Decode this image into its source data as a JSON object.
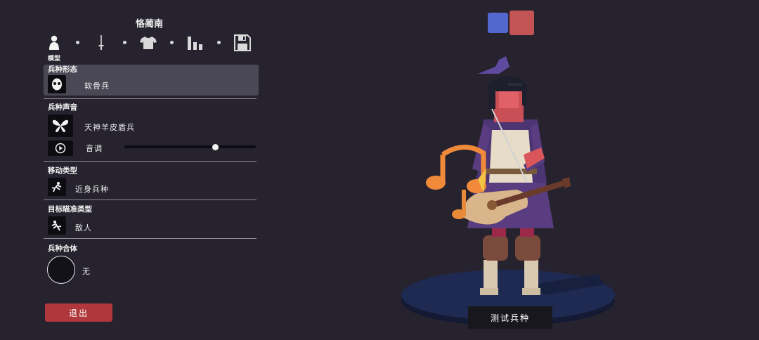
{
  "title": "恪蔺南",
  "tabs": [
    {
      "icon": "person-icon",
      "label": "模型"
    },
    {
      "icon": "sword-icon",
      "label": ""
    },
    {
      "icon": "shirt-icon",
      "label": ""
    },
    {
      "icon": "bars-icon",
      "label": ""
    },
    {
      "icon": "save-icon",
      "label": ""
    }
  ],
  "sections": {
    "form": {
      "label": "兵种形态",
      "value": "软骨兵",
      "icon": "skull-face-icon"
    },
    "voice": {
      "label": "兵种声音",
      "value": "天神羊皮盾兵",
      "icon": "butterfly-icon",
      "pitch_label": "音调",
      "pitch_value": 0.69
    },
    "movement": {
      "label": "移动类型",
      "value": "近身兵种",
      "icon": "unit-move-icon"
    },
    "targeting": {
      "label": "目标瞄准类型",
      "value": "敌人",
      "icon": "unit-target-icon"
    },
    "combine": {
      "label": "兵种合体",
      "value": "无"
    }
  },
  "buttons": {
    "exit": "退出",
    "test": "测试兵种"
  },
  "colors": {
    "team_blue": "#5267cf",
    "team_red": "#c25455",
    "exit_button": "#b0373b"
  }
}
